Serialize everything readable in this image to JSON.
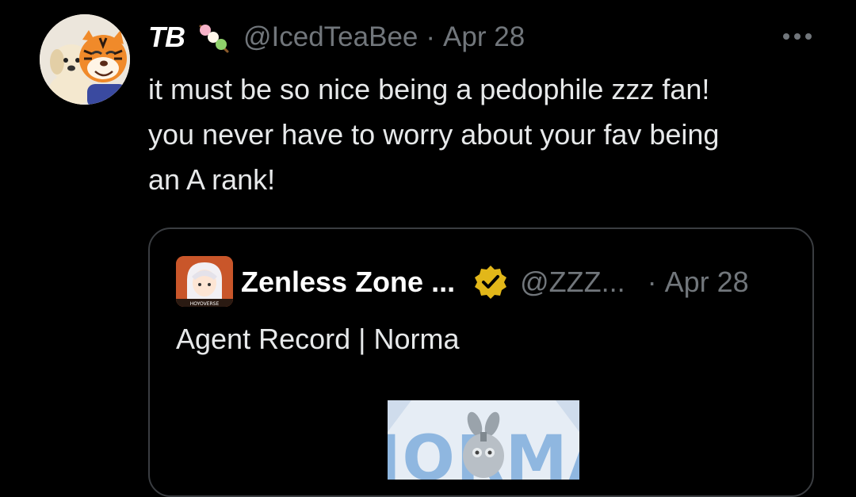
{
  "post": {
    "display_name": "TB",
    "name_emoji": "dango-emoji",
    "handle": "@IcedTeaBee",
    "separator": "·",
    "timestamp": "Apr 28",
    "more_icon": "more-horizontal-icon",
    "text_lines": [
      "it must be so nice being a pedophile zzz fan!",
      "you never have to worry about your fav being",
      "an A rank!"
    ]
  },
  "quoted_post": {
    "display_name": "Zenless Zone ...",
    "verified_icon": "verified-gold-badge-icon",
    "handle": "@ZZZ...",
    "separator": "·",
    "timestamp": "Apr 28",
    "avatar_caption": "HOYOVERSE",
    "text": "Agent Record | Norma",
    "media_caption": "NORMA"
  },
  "colors": {
    "background": "#000000",
    "primary_text": "#e7e9ea",
    "secondary_text": "#71767b",
    "card_border": "#3a3d41",
    "verified_gold": "#e2b719"
  }
}
